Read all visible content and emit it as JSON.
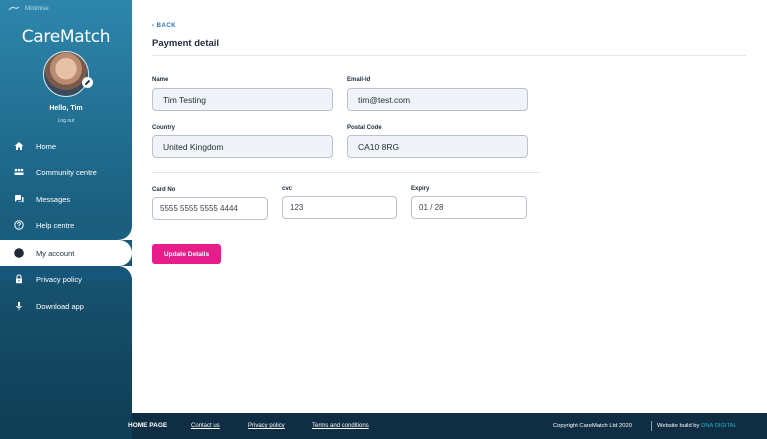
{
  "sidebar": {
    "minimise_label": "Minimise",
    "logo_text": "CareMatch",
    "greeting": "Hello, Tim",
    "logout_label": "Log out",
    "items": [
      {
        "label": "Home",
        "icon": "home-icon"
      },
      {
        "label": "Community centre",
        "icon": "community-icon"
      },
      {
        "label": "Messages",
        "icon": "messages-icon"
      },
      {
        "label": "Help centre",
        "icon": "help-icon"
      },
      {
        "label": "My account",
        "icon": "account-icon",
        "active": true
      },
      {
        "label": "Privacy policy",
        "icon": "lock-icon"
      },
      {
        "label": "Download app",
        "icon": "microphone-icon"
      }
    ]
  },
  "main": {
    "back_label": "BACK",
    "title": "Payment detail",
    "fields": {
      "name": {
        "label": "Name",
        "value": "Tim Testing"
      },
      "email": {
        "label": "Email-Id",
        "value": "tim@test.com"
      },
      "country": {
        "label": "Country",
        "value": "United Kingdom"
      },
      "postal": {
        "label": "Postal Code",
        "value": "CA10 8RG"
      },
      "card": {
        "label": "Card No",
        "value": "5555 5555 5555 4444"
      },
      "cvc": {
        "label": "cvc",
        "value": "123"
      },
      "expiry": {
        "label": "Expiry",
        "value": "01 / 28"
      }
    },
    "update_label": "Update Details"
  },
  "footer": {
    "home_label": "HOME PAGE",
    "contact_label": "Contact us",
    "privacy_label": "Privacy policy",
    "terms_label": "Terms and conditions",
    "copyright": "Copyright CareMatch Ltd 2020",
    "build_prefix": "Website build by",
    "build_brand": "DNA DIGITAL"
  },
  "colors": {
    "accent": "#e51e8b",
    "sidebar_top": "#2e86ac",
    "sidebar_bottom": "#0f3d55",
    "footer": "#0f2e44",
    "brand_link": "#1fb3c9"
  }
}
